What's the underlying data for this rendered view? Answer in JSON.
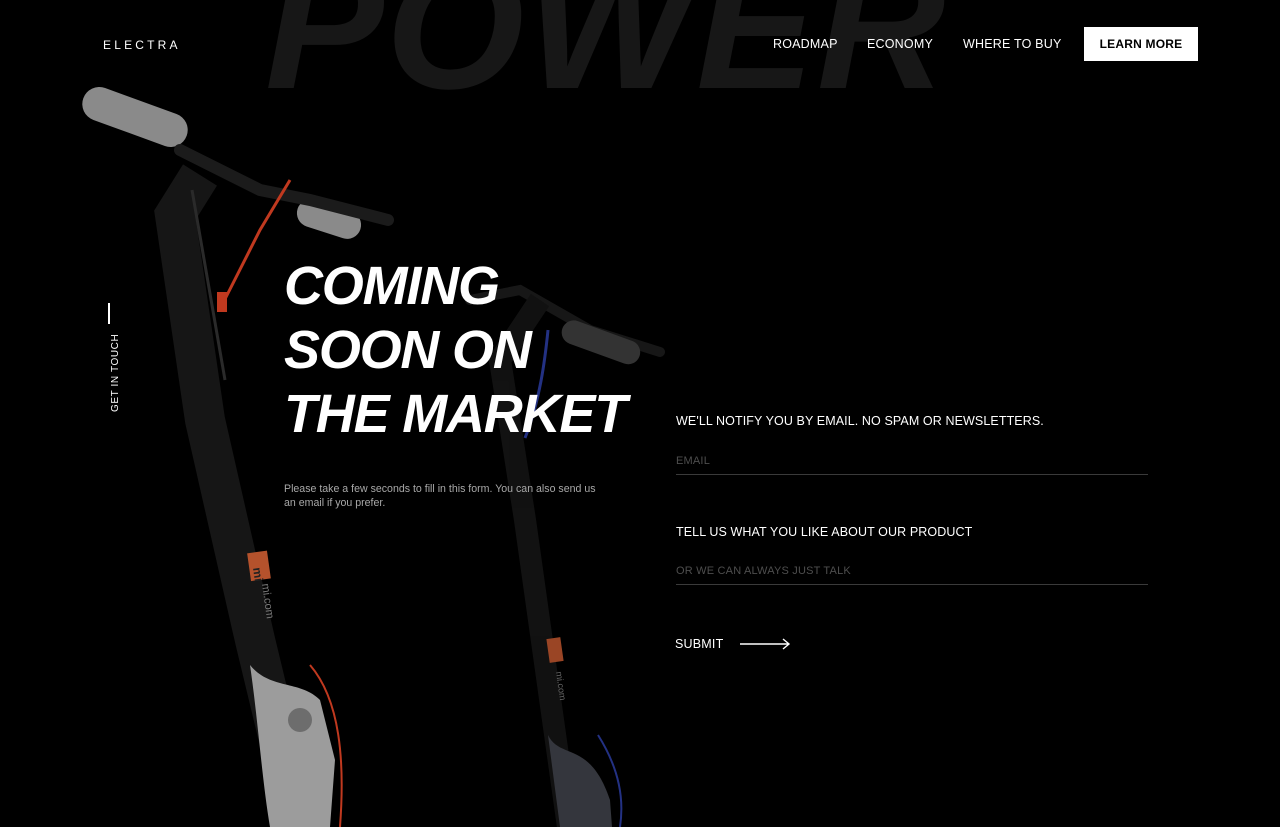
{
  "background_word": "POWER",
  "brand": "ELECTRA",
  "nav": {
    "roadmap": "ROADMAP",
    "economy": "ECONOMY",
    "where_to_buy": "WHERE TO BUY",
    "learn_more": "LEARN MORE"
  },
  "side": {
    "get_in_touch": "GET IN TOUCH"
  },
  "hero": {
    "line1": "COMING",
    "line2": "SOON ON",
    "line3": "THE MARKET",
    "description": "Please take a few seconds to fill in this form. You can also send us an email if you prefer."
  },
  "scooter": {
    "decal_brand": "mi",
    "decal_site": "mi.com",
    "accent_front": "#c0391f",
    "accent_back": "#2a3a9a"
  },
  "form": {
    "notify_text": "WE'LL NOTIFY YOU BY EMAIL. NO SPAM OR NEWSLETTERS.",
    "email_placeholder": "EMAIL",
    "email_value": "",
    "tell_label": "TELL US WHAT YOU LIKE ABOUT OUR PRODUCT",
    "message_placeholder": "OR WE CAN ALWAYS JUST TALK",
    "message_value": "",
    "submit_label": "SUBMIT"
  }
}
